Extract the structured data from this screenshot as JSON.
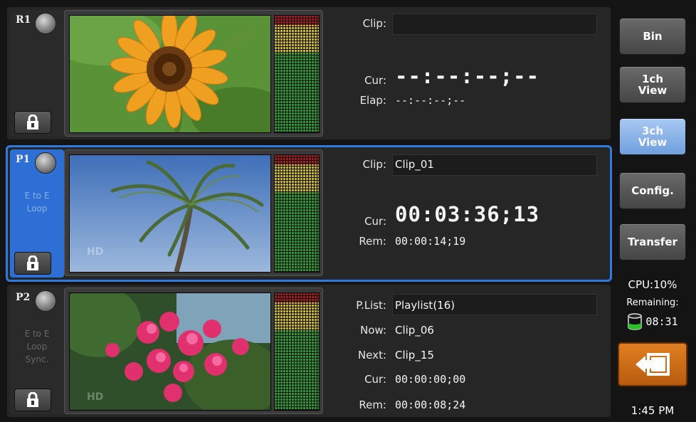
{
  "channels": [
    {
      "id": "R1",
      "mode_lines": [
        "",
        "",
        ""
      ],
      "fields": [
        {
          "label": "Clip:",
          "value": ""
        },
        {
          "label": "Cur:",
          "value": "--:--:--;--"
        },
        {
          "label": "Elap:",
          "value": "--:--:--;--"
        }
      ],
      "video_desc": "sunflower"
    },
    {
      "id": "P1",
      "mode_lines": [
        "E to E",
        "Loop",
        ""
      ],
      "fields": [
        {
          "label": "Clip:",
          "value": "Clip_01"
        },
        {
          "label": "Cur:",
          "value": "00:03:36;13"
        },
        {
          "label": "Rem:",
          "value": "00:00:14;19"
        }
      ],
      "video_desc": "palm tree"
    },
    {
      "id": "P2",
      "mode_lines": [
        "E to E",
        "Loop",
        "Sync."
      ],
      "fields": [
        {
          "label": "P.List:",
          "value": "Playlist(16)"
        },
        {
          "label": "Now:",
          "value": "Clip_06"
        },
        {
          "label": "Next:",
          "value": "Clip_15"
        },
        {
          "label": "Cur:",
          "value": "00:00:00;00"
        },
        {
          "label": "Rem:",
          "value": "00:00:08;24"
        }
      ],
      "video_desc": "bougainvillea"
    }
  ],
  "sidebar": {
    "bin": "Bin",
    "one_ch_view": "1ch\nView",
    "three_ch_view": "3ch\nView",
    "config": "Config.",
    "transfer": "Transfer"
  },
  "status": {
    "cpu": "CPU:10%",
    "remaining_label": "Remaining:",
    "remaining_time": "08:31",
    "clock": "1:45 PM"
  },
  "icons": {
    "lock": "lock-icon",
    "exit": "exit-arrow-icon",
    "disk": "storage-cylinder-icon"
  },
  "colors": {
    "active_blue": "#2f7ae0",
    "selected_button": "#8db6ea",
    "exit_orange": "#d4731b"
  }
}
